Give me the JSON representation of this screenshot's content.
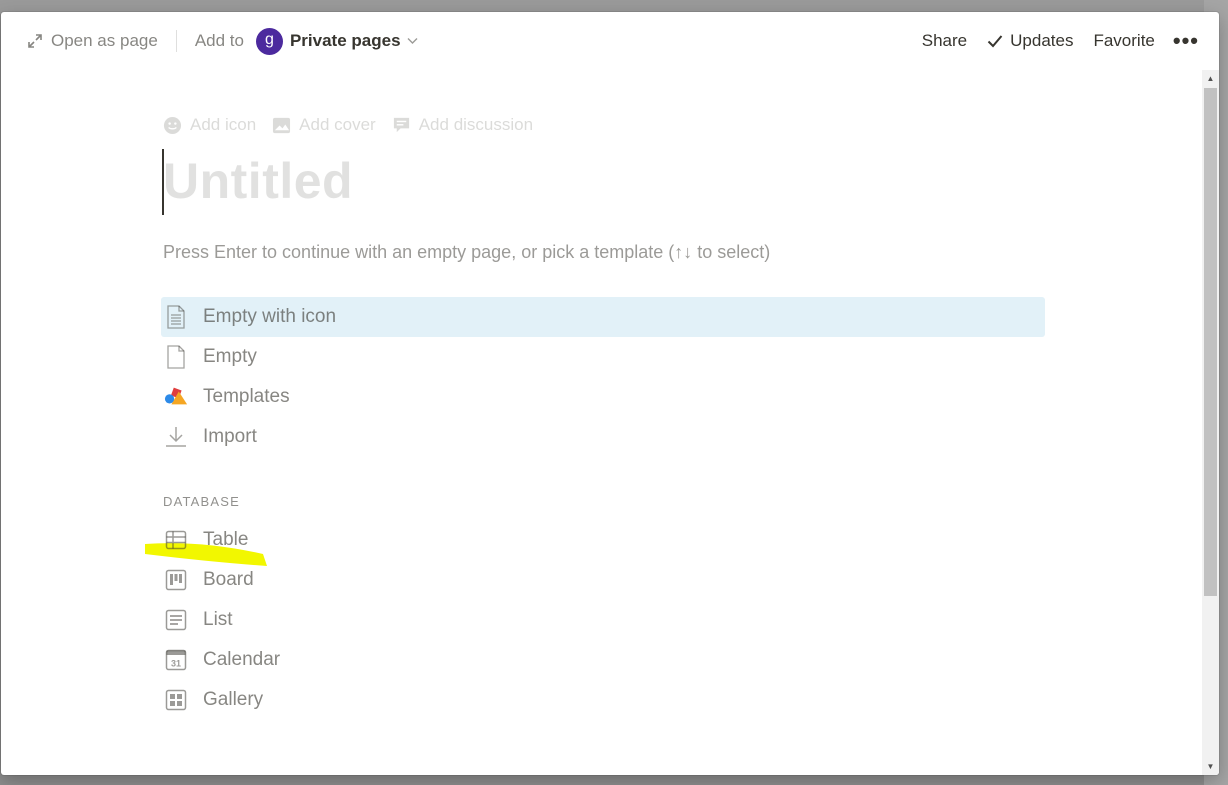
{
  "header": {
    "open_as_page": "Open as page",
    "add_to": "Add to",
    "workspace_initial": "g",
    "workspace_name": "Private pages",
    "share": "Share",
    "updates": "Updates",
    "favorite": "Favorite",
    "more": "•••"
  },
  "page": {
    "actions": {
      "add_icon": "Add icon",
      "add_cover": "Add cover",
      "add_discussion": "Add discussion"
    },
    "title_placeholder": "Untitled",
    "hint": "Press Enter to continue with an empty page, or pick a template (↑↓ to select)"
  },
  "templates": [
    {
      "label": "Empty with icon",
      "icon": "page-lines-icon",
      "selected": true
    },
    {
      "label": "Empty",
      "icon": "page-icon"
    },
    {
      "label": "Templates",
      "icon": "shapes-icon"
    },
    {
      "label": "Import",
      "icon": "download-icon"
    }
  ],
  "database": {
    "section_label": "DATABASE",
    "items": [
      {
        "label": "Table",
        "icon": "table-icon",
        "highlighted": true
      },
      {
        "label": "Board",
        "icon": "board-icon"
      },
      {
        "label": "List",
        "icon": "list-icon"
      },
      {
        "label": "Calendar",
        "icon": "calendar-icon",
        "day": "31"
      },
      {
        "label": "Gallery",
        "icon": "gallery-icon"
      }
    ]
  },
  "colors": {
    "selected_row": "#e2f1f8",
    "avatar": "#4c2a9e",
    "highlighter": "#f2f700"
  }
}
